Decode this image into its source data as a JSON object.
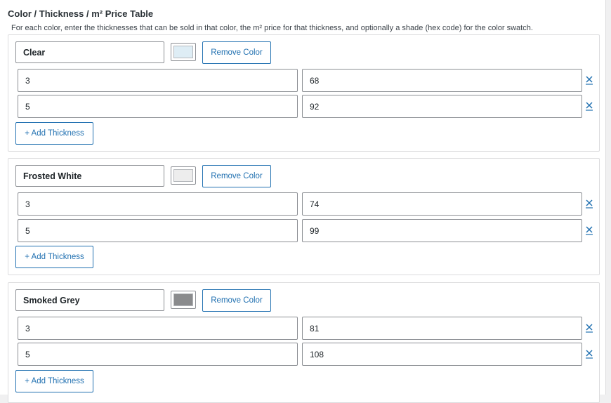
{
  "title": "Color / Thickness / m² Price Table",
  "description": "For each color, enter the thicknesses that can be sold in that color, the m² price for that thickness, and optionally a shade (hex code) for the color swatch.",
  "remove_color_label": "Remove Color",
  "add_thickness_label": "+ Add Thickness",
  "colors": [
    {
      "name": "Clear",
      "swatch_color": "#deedf5",
      "rows": [
        {
          "thickness": "3",
          "price": "68"
        },
        {
          "thickness": "5",
          "price": "92"
        }
      ]
    },
    {
      "name": "Frosted White",
      "swatch_color": "#ededed",
      "rows": [
        {
          "thickness": "3",
          "price": "74"
        },
        {
          "thickness": "5",
          "price": "99"
        }
      ]
    },
    {
      "name": "Smoked Grey",
      "swatch_color": "#8a8b8d",
      "rows": [
        {
          "thickness": "3",
          "price": "81"
        },
        {
          "thickness": "5",
          "price": "108"
        }
      ]
    }
  ],
  "accent_color": "#2271b1"
}
